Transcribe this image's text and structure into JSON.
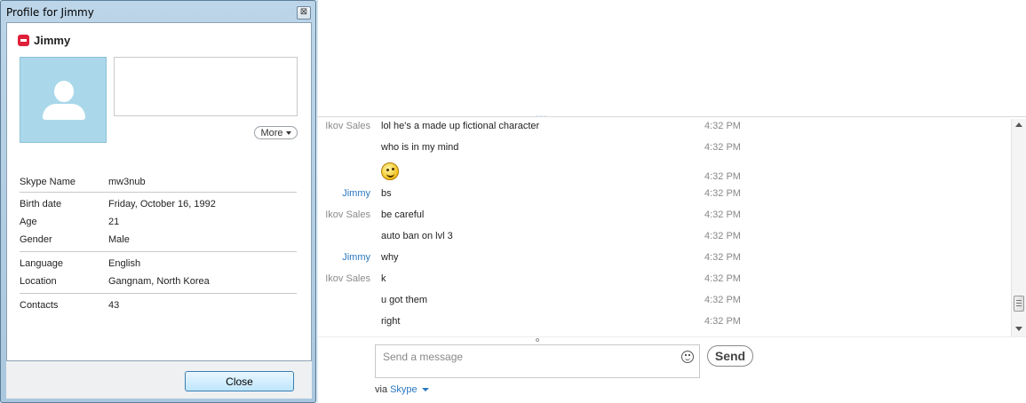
{
  "dialog": {
    "title": "Profile for Jimmy",
    "close_x": "⊠",
    "name": "Jimmy",
    "more_label": "More",
    "fields": [
      {
        "label": "Skype Name",
        "value": "mw3nub"
      },
      {
        "label": "Birth date",
        "value": "Friday, October 16, 1992"
      },
      {
        "label": "Age",
        "value": "21"
      },
      {
        "label": "Gender",
        "value": "Male"
      },
      {
        "label": "Language",
        "value": "English"
      },
      {
        "label": "Location",
        "value": "Gangnam, North Korea"
      },
      {
        "label": "Contacts",
        "value": "43"
      }
    ],
    "close_button": "Close"
  },
  "chat": {
    "resize_dots": "...",
    "messages": [
      {
        "sender": "Ikov Sales",
        "text": "lol he's a made up fictional character",
        "time": "4:32 PM"
      },
      {
        "sender": "",
        "text": "who is in my mind",
        "time": "4:32 PM"
      },
      {
        "sender": "",
        "text": "",
        "emoticon": "smile",
        "time": "4:32 PM"
      },
      {
        "sender": "Jimmy",
        "text": "bs",
        "time": "4:32 PM"
      },
      {
        "sender": "Ikov Sales",
        "text": "be careful",
        "time": "4:32 PM"
      },
      {
        "sender": "",
        "text": "auto ban on lvl 3",
        "time": "4:32 PM"
      },
      {
        "sender": "Jimmy",
        "text": "why",
        "time": "4:32 PM"
      },
      {
        "sender": "Ikov Sales",
        "text": "k",
        "time": "4:32 PM"
      },
      {
        "sender": "",
        "text": "u got them",
        "time": "4:32 PM"
      },
      {
        "sender": "",
        "text": "right",
        "time": "4:32 PM"
      }
    ],
    "input_placeholder": "Send a message",
    "send_label": "Send",
    "via_label": "via",
    "via_link": "Skype"
  },
  "colors": {
    "accent": "#2a78c0",
    "status_red": "#e0203a",
    "avatar_bg": "#aad8ea"
  }
}
